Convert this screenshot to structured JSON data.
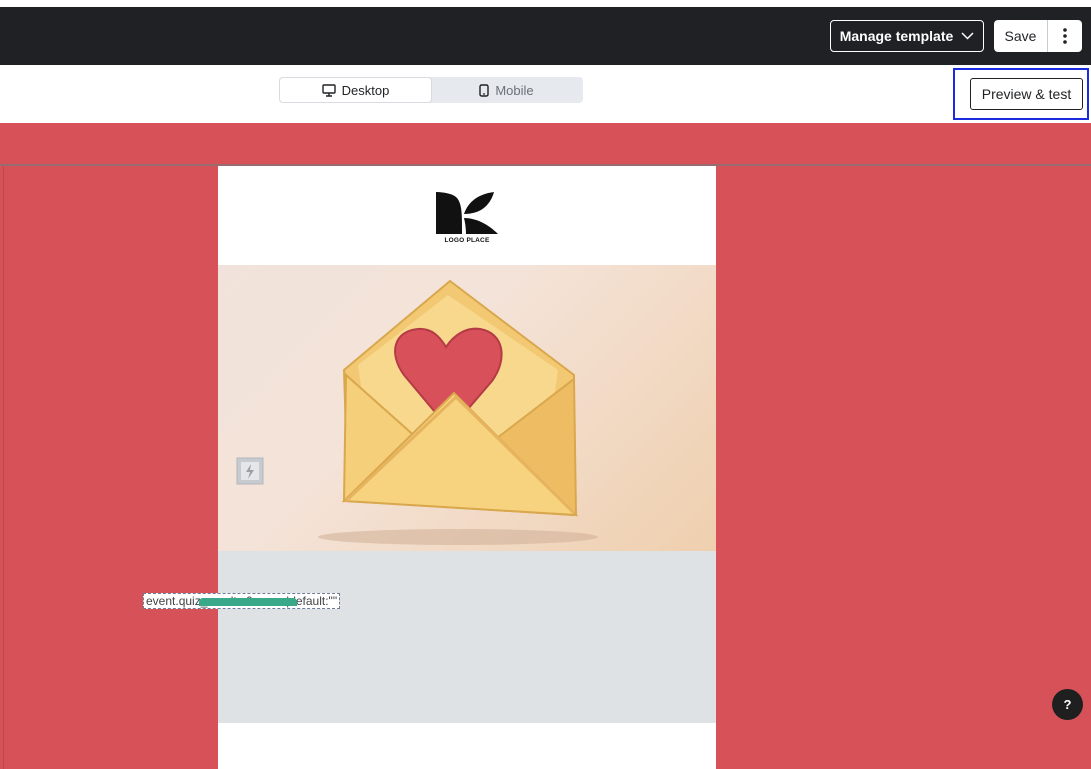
{
  "header": {
    "manage_template_label": "Manage template",
    "save_label": "Save"
  },
  "view_toggle": {
    "options": [
      {
        "label": "Desktop",
        "icon": "monitor-icon",
        "active": true
      },
      {
        "label": "Mobile",
        "icon": "mobile-icon",
        "active": false
      }
    ]
  },
  "preview_test_label": "Preview & test",
  "email": {
    "logo_text": "LOGO PLACE",
    "hero_image": "envelope-with-heart-illustration",
    "placeholder_icon": "image-placeholder-icon",
    "liquid_text": "event.quiz_results.0.name|default:\"\""
  },
  "help_label": "?",
  "colors": {
    "topbar": "#1f2124",
    "canvas_background": "#d75158",
    "focus_outline": "#1a2ae0",
    "button_green": "#3aa98a"
  }
}
